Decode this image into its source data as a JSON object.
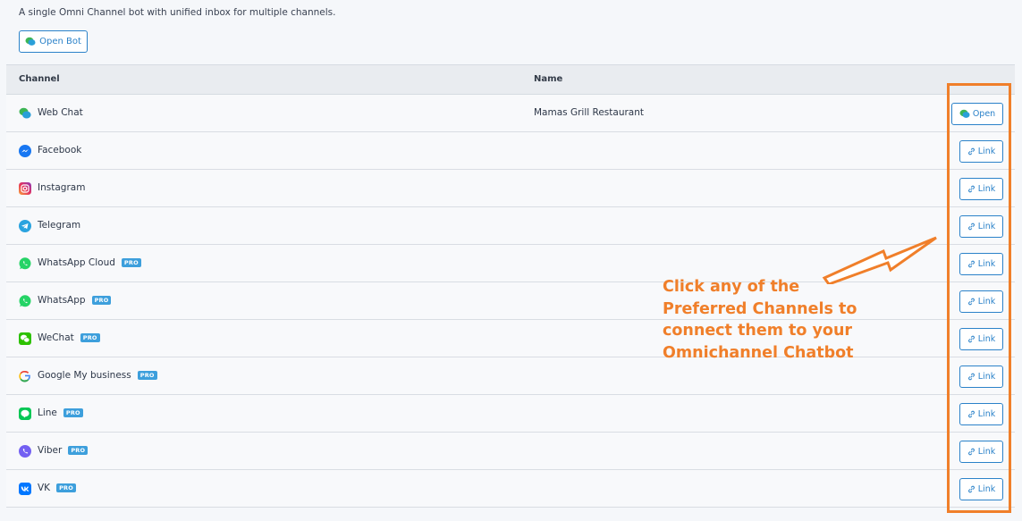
{
  "description": "A single Omni Channel bot with unified inbox for multiple channels.",
  "open_bot_label": "Open Bot",
  "table": {
    "header_channel": "Channel",
    "header_name": "Name",
    "rows": [
      {
        "channel": "Web Chat",
        "icon": "webchat-icon",
        "name": "Mamas Grill Restaurant",
        "pro": "",
        "action": "Open"
      },
      {
        "channel": "Facebook",
        "icon": "facebook-messenger-icon",
        "name": "",
        "pro": "",
        "action": "Link"
      },
      {
        "channel": "Instagram",
        "icon": "instagram-icon",
        "name": "",
        "pro": "",
        "action": "Link"
      },
      {
        "channel": "Telegram",
        "icon": "telegram-icon",
        "name": "",
        "pro": "",
        "action": "Link"
      },
      {
        "channel": "WhatsApp Cloud",
        "icon": "whatsapp-icon",
        "name": "",
        "pro": "PRO",
        "action": "Link"
      },
      {
        "channel": "WhatsApp",
        "icon": "whatsapp-icon",
        "name": "",
        "pro": "PRO",
        "action": "Link"
      },
      {
        "channel": "WeChat",
        "icon": "wechat-icon",
        "name": "",
        "pro": "PRO",
        "action": "Link"
      },
      {
        "channel": "Google My business",
        "icon": "google-icon",
        "name": "",
        "pro": "PRO",
        "action": "Link"
      },
      {
        "channel": "Line",
        "icon": "line-icon",
        "name": "",
        "pro": "PRO",
        "action": "Link"
      },
      {
        "channel": "Viber",
        "icon": "viber-icon",
        "name": "",
        "pro": "PRO",
        "action": "Link"
      },
      {
        "channel": "VK",
        "icon": "vk-icon",
        "name": "",
        "pro": "PRO",
        "action": "Link"
      }
    ]
  },
  "annotation_lines": [
    "Click any of the",
    "Preferred Channels to",
    "connect them to your",
    "Omnichannel Chatbot"
  ],
  "colors": {
    "accent": "#2b82c9",
    "annotation": "#f07f2a",
    "pro_badge": "#3d9fdc"
  }
}
